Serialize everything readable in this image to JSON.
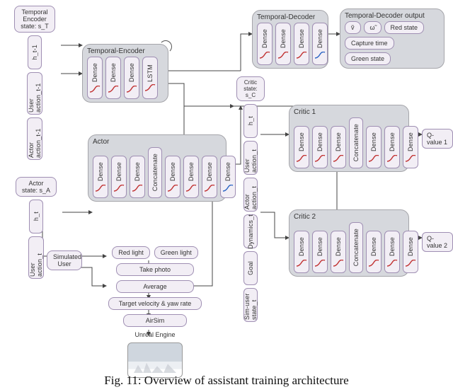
{
  "caption": "Fig. 11: Overview of assistant training architecture",
  "temporal_encoder_state": {
    "label": "Temporal\nEncoder\nstate: s_T",
    "items": [
      "h_t-1",
      "User action_t-1",
      "Actor action_t-1"
    ]
  },
  "temporal_encoder": {
    "title": "Temporal-Encoder",
    "layers": [
      "Dense",
      "Dense",
      "Dense",
      "LSTM"
    ]
  },
  "temporal_decoder": {
    "title": "Temporal-Decoder",
    "layers": [
      "Dense",
      "Dense",
      "Dense",
      "Dense"
    ]
  },
  "temporal_decoder_output": {
    "title": "Temporal-Decoder output",
    "items": [
      "ṽ",
      "ω̃",
      "Red state",
      "Capture time",
      "Green state"
    ]
  },
  "actor_state": {
    "label": "Actor\nstate: s_A",
    "items": [
      "h_t",
      "User action_t"
    ]
  },
  "actor": {
    "title": "Actor",
    "pre_layers": [
      "Dense",
      "Dense",
      "Dense"
    ],
    "concat": "Concatenate",
    "post_layers": [
      "Dense",
      "Dense",
      "Dense",
      "Dense"
    ]
  },
  "critic_state": {
    "label": "Critic\nstate: s_C",
    "items": [
      "h_t",
      "User action_t",
      "Actor action_t",
      "Dynamics_t",
      "Goal",
      "Sim-user state_t"
    ]
  },
  "critic1": {
    "title": "Critic 1",
    "pre_layers": [
      "Dense",
      "Dense",
      "Dense"
    ],
    "concat": "Concatenate",
    "post_layers": [
      "Dense",
      "Dense",
      "Dense"
    ],
    "out": "Q-value 1"
  },
  "critic2": {
    "title": "Critic 2",
    "pre_layers": [
      "Dense",
      "Dense",
      "Dense"
    ],
    "concat": "Concatenate",
    "post_layers": [
      "Dense",
      "Dense",
      "Dense"
    ],
    "out": "Q-value 2"
  },
  "sim_user": {
    "label": "Simulated\nUser",
    "lights": [
      "Red light",
      "Green light"
    ],
    "take_photo": "Take photo",
    "average": "Average",
    "target": "Target velocity & yaw rate",
    "airsim": "AirSim",
    "engine": "Unreal Engine"
  }
}
